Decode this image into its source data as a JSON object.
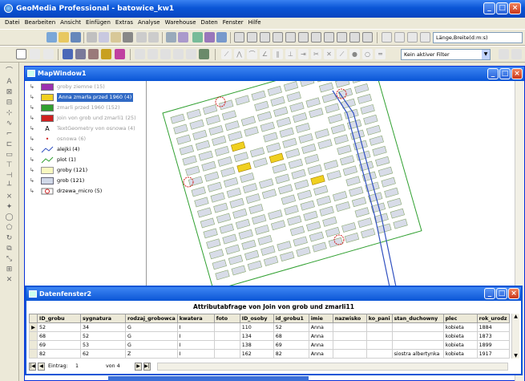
{
  "app": {
    "title": "GeoMedia Professional - batowice_kw1",
    "window_buttons": [
      "_",
      "□",
      "×"
    ]
  },
  "menu": [
    "Datei",
    "Bearbeiten",
    "Ansicht",
    "Einfügen",
    "Extras",
    "Analyse",
    "Warehouse",
    "Daten",
    "Fenster",
    "Hilfe"
  ],
  "toolbar": {
    "coord_format": "Länge,Breite(d:m:s)",
    "filter": "Kein aktiver Filter"
  },
  "map_window": {
    "title": "MapWindow1",
    "legend": [
      {
        "label": "groby ziemne (15)",
        "style": "dim",
        "color": "#9b30b0"
      },
      {
        "label": "Anna zmarła przed 1960 (4)",
        "style": "selected",
        "color": "#f0d020"
      },
      {
        "label": "zmarli przed 1960 (152)",
        "style": "dim",
        "color": "#30a030"
      },
      {
        "label": "Join von grob und zmarli1 (25)",
        "style": "dim",
        "color": "#d02020"
      },
      {
        "label": "TextGeometry von osnowa (4)",
        "style": "dim",
        "color": "#444"
      },
      {
        "label": "osnowa (6)",
        "style": "dim",
        "color": "#d02020"
      },
      {
        "label": "alejki (4)",
        "style": "normal",
        "color": "#3050c0"
      },
      {
        "label": "plot (1)",
        "style": "normal",
        "color": "#30a030"
      },
      {
        "label": "groby (121)",
        "style": "normal",
        "color": "#f8f8c0"
      },
      {
        "label": "grob (121)",
        "style": "normal",
        "color": "#d0d8e8"
      },
      {
        "label": "drzewa_micro (5)",
        "style": "normal",
        "color": "#d02020"
      }
    ]
  },
  "data_window": {
    "title": "Datenfenster2",
    "caption": "Attributabfrage von  Join von  grob und  zmarli11",
    "columns": [
      "ID_grobu",
      "sygnatura",
      "rodzaj_grobowca",
      "kwatera",
      "foto",
      "ID_osoby",
      "id_grobu1",
      "imie",
      "nazwisko",
      "ko_pani",
      "stan_duchowny",
      "plec",
      "rok_urodz"
    ],
    "rows": [
      [
        "52",
        "34",
        "G",
        "I",
        "",
        "110",
        "52",
        "Anna",
        "",
        "",
        "",
        "kobieta",
        "1884"
      ],
      [
        "68",
        "52",
        "G",
        "I",
        "",
        "134",
        "68",
        "Anna",
        "",
        "",
        "",
        "kobieta",
        "1873"
      ],
      [
        "69",
        "53",
        "G",
        "I",
        "",
        "138",
        "69",
        "Anna",
        "",
        "",
        "",
        "kobieta",
        "1899"
      ],
      [
        "82",
        "62",
        "Z",
        "I",
        "",
        "162",
        "82",
        "Anna",
        "",
        "",
        "siostra albertynka",
        "kobieta",
        "1917"
      ]
    ],
    "nav": {
      "label": "Eintrag:",
      "current": "1",
      "of_label": "von 4"
    }
  },
  "colors": {
    "titlebar": "#0a55d6",
    "highlight": "#f0d020",
    "fence": "#30a030",
    "path": "#3050c0",
    "tree": "#d02020"
  }
}
